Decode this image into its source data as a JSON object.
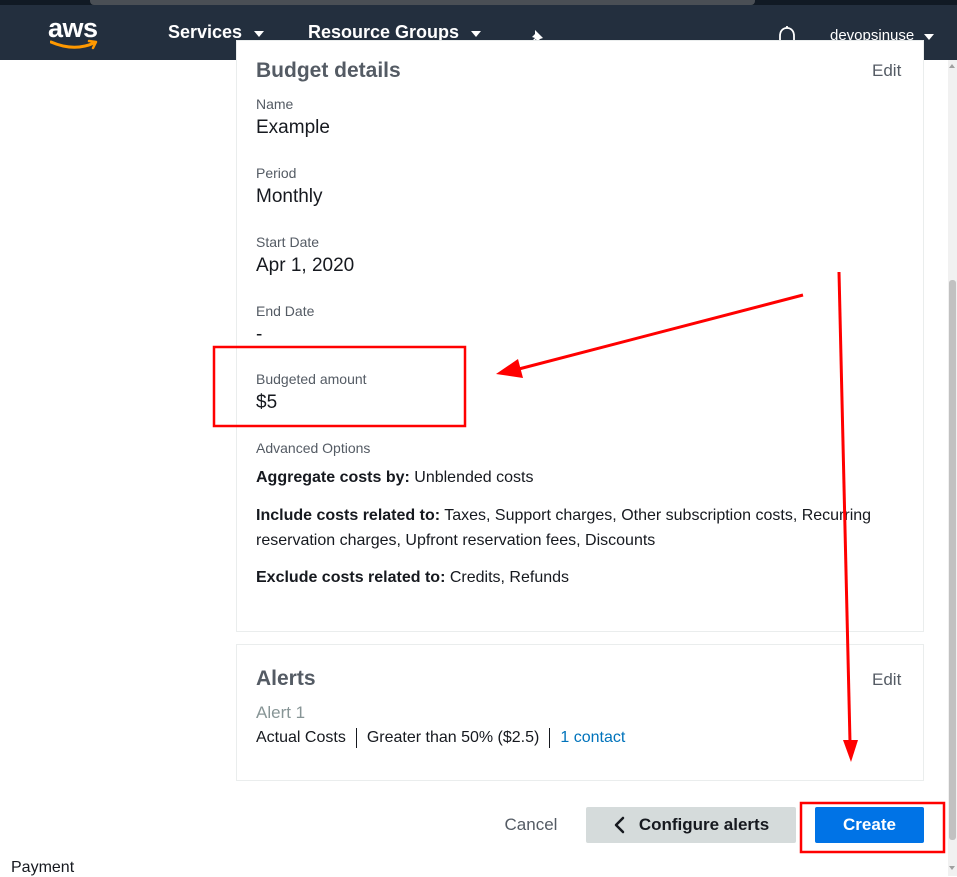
{
  "topnav": {
    "logo_text": "aws",
    "services_label": "Services",
    "resource_groups_label": "Resource Groups",
    "username": "devopsinuse"
  },
  "side_nav": {
    "payment_label": "Payment"
  },
  "budget_details": {
    "title": "Budget details",
    "edit_label": "Edit",
    "name_label": "Name",
    "name_value": "Example",
    "period_label": "Period",
    "period_value": "Monthly",
    "start_date_label": "Start Date",
    "start_date_value": "Apr 1, 2020",
    "end_date_label": "End Date",
    "end_date_value": "-",
    "budgeted_amount_label": "Budgeted amount",
    "budgeted_amount_value": "$5",
    "advanced_options_label": "Advanced Options",
    "aggregate_label": "Aggregate costs by:",
    "aggregate_value": "Unblended costs",
    "include_label": "Include costs related to:",
    "include_value": "Taxes, Support charges, Other subscription costs, Recurring reservation charges, Upfront reservation fees, Discounts",
    "exclude_label": "Exclude costs related to:",
    "exclude_value": "Credits, Refunds"
  },
  "alerts": {
    "title": "Alerts",
    "edit_label": "Edit",
    "alert_name": "Alert 1",
    "cost_type": "Actual Costs",
    "threshold": "Greater than 50% ($2.5)",
    "contacts": "1 contact"
  },
  "actions": {
    "cancel_label": "Cancel",
    "configure_alerts_label": "Configure alerts",
    "create_label": "Create"
  },
  "colors": {
    "nav_background": "#232f3e",
    "primary_button": "#0073e6",
    "link": "#0073bb",
    "annotation": "#ff0000"
  }
}
